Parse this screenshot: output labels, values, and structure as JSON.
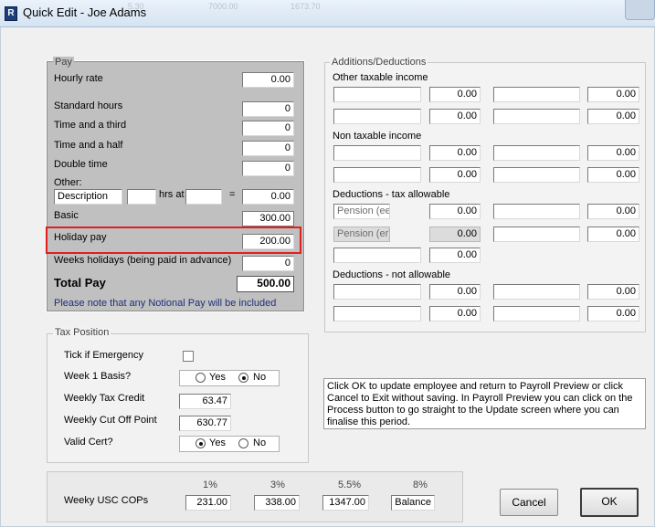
{
  "window": {
    "title": "Quick Edit - Joe Adams",
    "ghost": [
      "5.30",
      "7000.00",
      "1673.70"
    ]
  },
  "pay": {
    "group_label": "Pay",
    "hourly_rate": {
      "label": "Hourly rate",
      "value": "0.00"
    },
    "standard_hours": {
      "label": "Standard hours",
      "value": "0"
    },
    "time_and_third": {
      "label": "Time and a third",
      "value": "0"
    },
    "time_and_half": {
      "label": "Time and a half",
      "value": "0"
    },
    "double_time": {
      "label": "Double time",
      "value": "0"
    },
    "other": {
      "label": "Other:",
      "description": "Description",
      "hrs_at": "hrs at",
      "equals": "=",
      "value": "0.00"
    },
    "basic": {
      "label": "Basic",
      "value": "300.00"
    },
    "holiday_pay": {
      "label": "Holiday pay",
      "value": "200.00"
    },
    "weeks_holidays": {
      "label": "Weeks holidays (being paid in advance)",
      "value": "0"
    },
    "total_pay": {
      "label": "Total Pay",
      "value": "500.00"
    },
    "note": "Please note that any Notional Pay will be included"
  },
  "additions": {
    "group_label": "Additions/Deductions",
    "other_taxable": {
      "label": "Other taxable income",
      "values": [
        "0.00",
        "0.00",
        "0.00",
        "0.00"
      ]
    },
    "non_taxable": {
      "label": "Non taxable income",
      "values": [
        "0.00",
        "0.00",
        "0.00",
        "0.00"
      ]
    },
    "tax_allowable": {
      "label": "Deductions - tax allowable",
      "pension_ee": "Pension (ee)",
      "pension_er": "Pension (er)",
      "values": [
        "0.00",
        "0.00",
        "0.00",
        "0.00",
        "0.00"
      ]
    },
    "not_allowable": {
      "label": "Deductions - not allowable",
      "values": [
        "0.00",
        "0.00",
        "0.00",
        "0.00"
      ]
    }
  },
  "tax": {
    "group_label": "Tax Position",
    "emergency": "Tick if Emergency",
    "week1": "Week 1 Basis?",
    "yes": "Yes",
    "no": "No",
    "weekly_tax_credit": {
      "label": "Weekly Tax Credit",
      "value": "63.47"
    },
    "weekly_cut_off": {
      "label": "Weekly Cut Off Point",
      "value": "630.77"
    },
    "valid_cert": "Valid Cert?"
  },
  "info": "Click OK to update employee and return to Payroll Preview or click Cancel to Exit without saving. In Payroll Preview you can click on the Process button to go straight to the Update screen where you can finalise this period.",
  "usc": {
    "label": "Weeky USC COPs",
    "headers": [
      "1%",
      "3%",
      "5.5%",
      "8%"
    ],
    "values": [
      "231.00",
      "338.00",
      "1347.00",
      "Balance"
    ]
  },
  "buttons": {
    "cancel": "Cancel",
    "ok": "OK"
  }
}
